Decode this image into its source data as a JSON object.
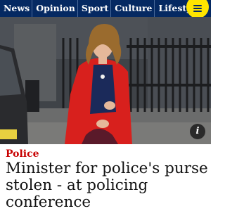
{
  "nav": {
    "items": [
      "News",
      "Opinion",
      "Sport",
      "Culture",
      "Lifestyle"
    ],
    "menu_icon": "hamburger-menu-icon"
  },
  "article": {
    "kicker": "Police",
    "headline": "Minister for police's purse stolen - at policing conference",
    "image_info_icon": "info-icon"
  },
  "colors": {
    "nav_bg": "#052962",
    "menu_button": "#ffe500",
    "kicker": "#c70000",
    "headline": "#121212"
  }
}
